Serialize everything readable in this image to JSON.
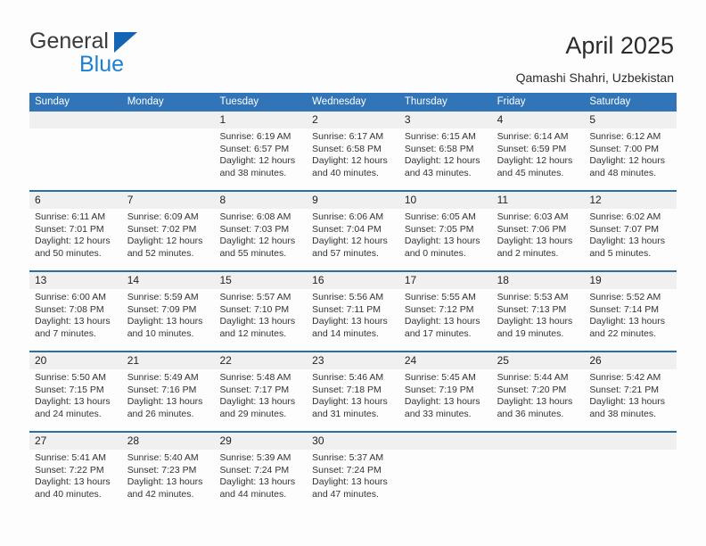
{
  "brand": {
    "name_part1": "General",
    "name_part2": "Blue",
    "accent_color": "#1464b4"
  },
  "header": {
    "title": "April 2025",
    "location": "Qamashi Shahri, Uzbekistan"
  },
  "calendar": {
    "header_bg": "#3175b8",
    "separator_color": "#2e6da4",
    "daynum_bg": "#f0f0f0",
    "weekdays": [
      "Sunday",
      "Monday",
      "Tuesday",
      "Wednesday",
      "Thursday",
      "Friday",
      "Saturday"
    ],
    "weeks": [
      {
        "daynums": [
          "",
          "",
          "1",
          "2",
          "3",
          "4",
          "5"
        ],
        "cells": [
          {
            "lines": []
          },
          {
            "lines": []
          },
          {
            "lines": [
              "Sunrise: 6:19 AM",
              "Sunset: 6:57 PM",
              "Daylight: 12 hours",
              "and 38 minutes."
            ]
          },
          {
            "lines": [
              "Sunrise: 6:17 AM",
              "Sunset: 6:58 PM",
              "Daylight: 12 hours",
              "and 40 minutes."
            ]
          },
          {
            "lines": [
              "Sunrise: 6:15 AM",
              "Sunset: 6:58 PM",
              "Daylight: 12 hours",
              "and 43 minutes."
            ]
          },
          {
            "lines": [
              "Sunrise: 6:14 AM",
              "Sunset: 6:59 PM",
              "Daylight: 12 hours",
              "and 45 minutes."
            ]
          },
          {
            "lines": [
              "Sunrise: 6:12 AM",
              "Sunset: 7:00 PM",
              "Daylight: 12 hours",
              "and 48 minutes."
            ]
          }
        ]
      },
      {
        "daynums": [
          "6",
          "7",
          "8",
          "9",
          "10",
          "11",
          "12"
        ],
        "cells": [
          {
            "lines": [
              "Sunrise: 6:11 AM",
              "Sunset: 7:01 PM",
              "Daylight: 12 hours",
              "and 50 minutes."
            ]
          },
          {
            "lines": [
              "Sunrise: 6:09 AM",
              "Sunset: 7:02 PM",
              "Daylight: 12 hours",
              "and 52 minutes."
            ]
          },
          {
            "lines": [
              "Sunrise: 6:08 AM",
              "Sunset: 7:03 PM",
              "Daylight: 12 hours",
              "and 55 minutes."
            ]
          },
          {
            "lines": [
              "Sunrise: 6:06 AM",
              "Sunset: 7:04 PM",
              "Daylight: 12 hours",
              "and 57 minutes."
            ]
          },
          {
            "lines": [
              "Sunrise: 6:05 AM",
              "Sunset: 7:05 PM",
              "Daylight: 13 hours",
              "and 0 minutes."
            ]
          },
          {
            "lines": [
              "Sunrise: 6:03 AM",
              "Sunset: 7:06 PM",
              "Daylight: 13 hours",
              "and 2 minutes."
            ]
          },
          {
            "lines": [
              "Sunrise: 6:02 AM",
              "Sunset: 7:07 PM",
              "Daylight: 13 hours",
              "and 5 minutes."
            ]
          }
        ]
      },
      {
        "daynums": [
          "13",
          "14",
          "15",
          "16",
          "17",
          "18",
          "19"
        ],
        "cells": [
          {
            "lines": [
              "Sunrise: 6:00 AM",
              "Sunset: 7:08 PM",
              "Daylight: 13 hours",
              "and 7 minutes."
            ]
          },
          {
            "lines": [
              "Sunrise: 5:59 AM",
              "Sunset: 7:09 PM",
              "Daylight: 13 hours",
              "and 10 minutes."
            ]
          },
          {
            "lines": [
              "Sunrise: 5:57 AM",
              "Sunset: 7:10 PM",
              "Daylight: 13 hours",
              "and 12 minutes."
            ]
          },
          {
            "lines": [
              "Sunrise: 5:56 AM",
              "Sunset: 7:11 PM",
              "Daylight: 13 hours",
              "and 14 minutes."
            ]
          },
          {
            "lines": [
              "Sunrise: 5:55 AM",
              "Sunset: 7:12 PM",
              "Daylight: 13 hours",
              "and 17 minutes."
            ]
          },
          {
            "lines": [
              "Sunrise: 5:53 AM",
              "Sunset: 7:13 PM",
              "Daylight: 13 hours",
              "and 19 minutes."
            ]
          },
          {
            "lines": [
              "Sunrise: 5:52 AM",
              "Sunset: 7:14 PM",
              "Daylight: 13 hours",
              "and 22 minutes."
            ]
          }
        ]
      },
      {
        "daynums": [
          "20",
          "21",
          "22",
          "23",
          "24",
          "25",
          "26"
        ],
        "cells": [
          {
            "lines": [
              "Sunrise: 5:50 AM",
              "Sunset: 7:15 PM",
              "Daylight: 13 hours",
              "and 24 minutes."
            ]
          },
          {
            "lines": [
              "Sunrise: 5:49 AM",
              "Sunset: 7:16 PM",
              "Daylight: 13 hours",
              "and 26 minutes."
            ]
          },
          {
            "lines": [
              "Sunrise: 5:48 AM",
              "Sunset: 7:17 PM",
              "Daylight: 13 hours",
              "and 29 minutes."
            ]
          },
          {
            "lines": [
              "Sunrise: 5:46 AM",
              "Sunset: 7:18 PM",
              "Daylight: 13 hours",
              "and 31 minutes."
            ]
          },
          {
            "lines": [
              "Sunrise: 5:45 AM",
              "Sunset: 7:19 PM",
              "Daylight: 13 hours",
              "and 33 minutes."
            ]
          },
          {
            "lines": [
              "Sunrise: 5:44 AM",
              "Sunset: 7:20 PM",
              "Daylight: 13 hours",
              "and 36 minutes."
            ]
          },
          {
            "lines": [
              "Sunrise: 5:42 AM",
              "Sunset: 7:21 PM",
              "Daylight: 13 hours",
              "and 38 minutes."
            ]
          }
        ]
      },
      {
        "daynums": [
          "27",
          "28",
          "29",
          "30",
          "",
          "",
          ""
        ],
        "cells": [
          {
            "lines": [
              "Sunrise: 5:41 AM",
              "Sunset: 7:22 PM",
              "Daylight: 13 hours",
              "and 40 minutes."
            ]
          },
          {
            "lines": [
              "Sunrise: 5:40 AM",
              "Sunset: 7:23 PM",
              "Daylight: 13 hours",
              "and 42 minutes."
            ]
          },
          {
            "lines": [
              "Sunrise: 5:39 AM",
              "Sunset: 7:24 PM",
              "Daylight: 13 hours",
              "and 44 minutes."
            ]
          },
          {
            "lines": [
              "Sunrise: 5:37 AM",
              "Sunset: 7:24 PM",
              "Daylight: 13 hours",
              "and 47 minutes."
            ]
          },
          {
            "lines": []
          },
          {
            "lines": []
          },
          {
            "lines": []
          }
        ]
      }
    ]
  }
}
